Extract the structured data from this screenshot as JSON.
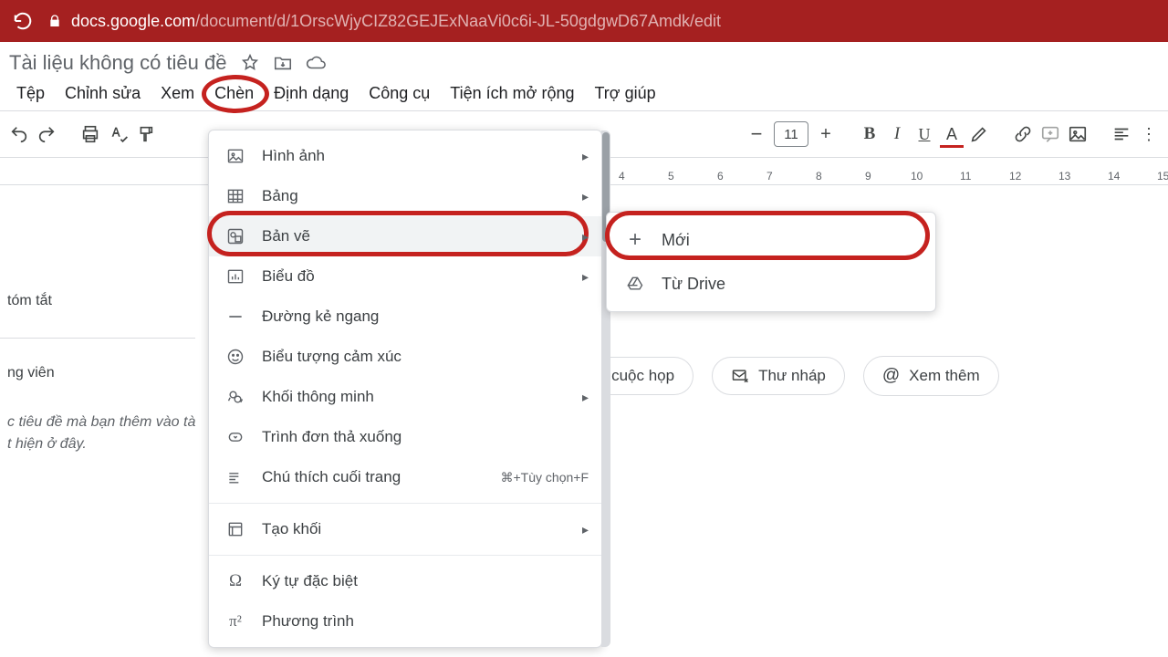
{
  "url": {
    "host": "docs.google.com",
    "path": "/document/d/1OrscWjyCIZ82GEJExNaaVi0c6i-JL-50gdgwD67Amdk/edit"
  },
  "doc": {
    "title": "Tài liệu không có tiêu đề"
  },
  "menubar": [
    "Tệp",
    "Chỉnh sửa",
    "Xem",
    "Chèn",
    "Định dạng",
    "Công cụ",
    "Tiện ích mở rộng",
    "Trợ giúp"
  ],
  "toolbar": {
    "fontsize": "11"
  },
  "ruler": {
    "start": 4,
    "end": 15
  },
  "sidebar": {
    "summary": "tóm tắt",
    "outline_h": "ng viên",
    "hint1": "c tiêu đề mà bạn thêm vào tà",
    "hint2": "t hiện ở đây."
  },
  "chips": {
    "part": "ni chú cuộc họp",
    "draft": "Thư nháp",
    "more": "Xem thêm"
  },
  "insert_menu": {
    "image": "Hình ảnh",
    "table": "Bảng",
    "drawing": "Bản vẽ",
    "chart": "Biểu đồ",
    "hr": "Đường kẻ ngang",
    "emoji": "Biểu tượng cảm xúc",
    "smart": "Khối thông minh",
    "dropdown": "Trình đơn thả xuống",
    "footnote": "Chú thích cuối trang",
    "footnote_sc": "⌘+Tùy chọn+F",
    "block": "Tạo khối",
    "special": "Ký tự đặc biệt",
    "equation": "Phương trình"
  },
  "drawing_submenu": {
    "new": "Mới",
    "drive": "Từ Drive"
  }
}
